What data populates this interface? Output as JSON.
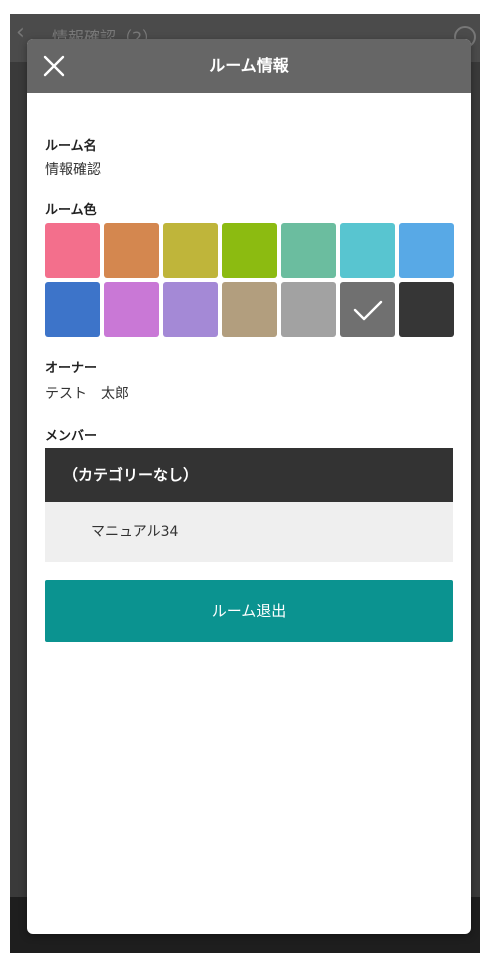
{
  "background_screen": {
    "title": "情報確認（2）"
  },
  "modal": {
    "title": "ルーム情報",
    "close_icon": "close-x-icon"
  },
  "room_name": {
    "label": "ルーム名",
    "value": "情報確認"
  },
  "room_color": {
    "label": "ルーム色",
    "swatches": [
      {
        "color": "#f36f8c",
        "selected": false
      },
      {
        "color": "#d4874f",
        "selected": false
      },
      {
        "color": "#bfb53a",
        "selected": false
      },
      {
        "color": "#8cbb11",
        "selected": false
      },
      {
        "color": "#6bbd9f",
        "selected": false
      },
      {
        "color": "#58c5d0",
        "selected": false
      },
      {
        "color": "#58a9e6",
        "selected": false
      },
      {
        "color": "#3d74c9",
        "selected": false
      },
      {
        "color": "#c978d6",
        "selected": false
      },
      {
        "color": "#a489d6",
        "selected": false
      },
      {
        "color": "#b29e7e",
        "selected": false
      },
      {
        "color": "#a2a2a2",
        "selected": false
      },
      {
        "color": "#707070",
        "selected": true
      },
      {
        "color": "#363636",
        "selected": false
      }
    ]
  },
  "owner": {
    "label": "オーナー",
    "value": "テスト　太郎"
  },
  "members": {
    "label": "メンバー",
    "category": "（カテゴリーなし）",
    "items": [
      {
        "name": "マニュアル34"
      }
    ]
  },
  "actions": {
    "leave_label": "ルーム退出",
    "leave_color": "#0b9390"
  }
}
